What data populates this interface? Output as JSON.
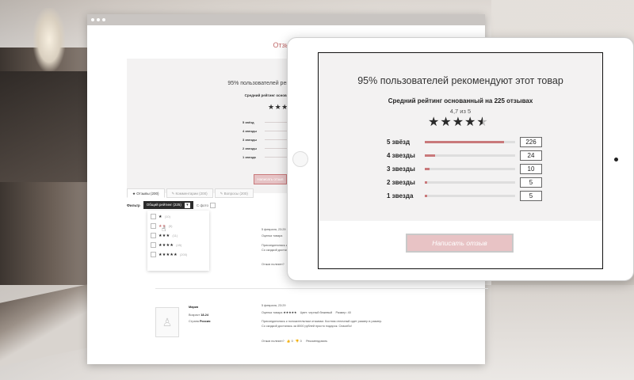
{
  "browser": {
    "page_title": "Отзывы",
    "summary": {
      "headline": "95% пользователей рекомендуют этот товар",
      "avg_text": "Средний рейтинг основанный на 225 отзывах",
      "stars": "★★★★★",
      "rows": [
        {
          "label": "5 звёзд",
          "fill": 0.85
        },
        {
          "label": "4 звезды",
          "fill": 0.12
        },
        {
          "label": "3 звезды",
          "fill": 0.05
        },
        {
          "label": "2 звезды",
          "fill": 0.03
        },
        {
          "label": "1 звезда",
          "fill": 0.03
        }
      ],
      "button_label": "Написать отзыв"
    },
    "tabs": [
      {
        "label": "★ Отзывы (200)"
      },
      {
        "label": "✎ Комментарии (200)"
      },
      {
        "label": "✎ Вопросы (200)"
      }
    ],
    "filter": {
      "label": "Фильтр",
      "select_value": "Общий рейтинг (225)",
      "photo_label": "С фото"
    },
    "dropdown": [
      {
        "stars": "★",
        "count": "(10)"
      },
      {
        "stars": "★★",
        "count": "(5)"
      },
      {
        "stars": "★★★",
        "count": "(11)"
      },
      {
        "stars": "★★★★",
        "count": "(45)"
      },
      {
        "stars": "★★★★★",
        "count": "(200)"
      }
    ],
    "review1": {
      "date": "5 февраля, 23:29",
      "rating_label": "Оценка товара",
      "text1": "Присоединилась к положительным отзывам...",
      "text2": "Со скидкой досталась...",
      "helpful": "Отзыв полезен?"
    },
    "review2": {
      "name": "Мария",
      "age_label": "Возраст",
      "age": "18-24",
      "country_label": "Страна",
      "country": "Россия",
      "date": "5 февраля, 23:29",
      "rating_label": "Оценка товара",
      "color_label": "Цвет:",
      "color": "черный бежевый",
      "size_label": "Размер:",
      "size": "40",
      "text1": "Присоединилась к положительным отзывам. Костюм отличный идет размер в размер.",
      "text2": "Со скидкой досталась за 8000 рублей просто подарок. Спасибо!",
      "helpful": "Отзыв полезен?",
      "likes": "0",
      "dislikes": "0",
      "recommend": "Рекомендовать"
    }
  },
  "tablet": {
    "headline": "95% пользователей рекомендуют этот товар",
    "avg_text": "Средний рейтинг основанный на 225 отзывах",
    "avg_of": "4,7 из 5",
    "rating_value": 4.7,
    "rows": [
      {
        "label": "5 звёзд",
        "count": "226",
        "fill": 0.88
      },
      {
        "label": "4 звезды",
        "count": "24",
        "fill": 0.11
      },
      {
        "label": "3 звезды",
        "count": "10",
        "fill": 0.05
      },
      {
        "label": "2 звезды",
        "count": "5",
        "fill": 0.03
      },
      {
        "label": "1 звезда",
        "count": "5",
        "fill": 0.03
      }
    ],
    "write_button": "Написать отзыв"
  },
  "colors": {
    "accent": "#c9797b",
    "button_bg": "#e8c3c5",
    "title": "#c26b6b"
  }
}
